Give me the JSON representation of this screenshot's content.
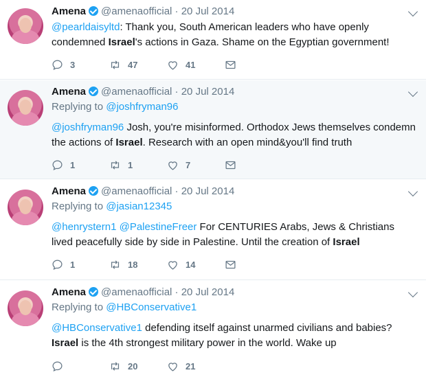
{
  "tweets": [
    {
      "name": "Amena",
      "handle": "@amenaofficial",
      "date": "20 Jul 2014",
      "reply_label": "",
      "reply_to": "",
      "text_parts": [
        "@pearldaisyltd",
        ": Thank you, South American leaders who have openly condemned ",
        "Israel",
        "'s actions in Gaza. Shame on the Egyptian government!"
      ],
      "replies": "3",
      "retweets": "47",
      "likes": "41"
    },
    {
      "name": "Amena",
      "handle": "@amenaofficial",
      "date": "20 Jul 2014",
      "reply_label": "Replying to",
      "reply_to": "@joshfryman96",
      "text_parts": [
        "@joshfryman96",
        " Josh, you're misinformed. Orthodox Jews themselves condemn the actions of ",
        "Israel",
        ". Research with an open mind&you'll find truth"
      ],
      "replies": "1",
      "retweets": "1",
      "likes": "7"
    },
    {
      "name": "Amena",
      "handle": "@amenaofficial",
      "date": "20 Jul 2014",
      "reply_label": "Replying to",
      "reply_to": "@jasian12345",
      "text_parts": [
        "@henrystern1 @PalestineFreer",
        " For CENTURIES Arabs, Jews & Christians lived peacefully side by side in Palestine. Until the creation of ",
        "Israel",
        ""
      ],
      "replies": "1",
      "retweets": "18",
      "likes": "14"
    },
    {
      "name": "Amena",
      "handle": "@amenaofficial",
      "date": "20 Jul 2014",
      "reply_label": "Replying to",
      "reply_to": "@HBConservative1",
      "text_parts": [
        "@HBConservative1",
        " defending itself against unarmed civilians and babies? ",
        "Israel",
        " is the 4th strongest military power in the world. Wake up"
      ],
      "replies": "",
      "retweets": "20",
      "likes": "21"
    }
  ],
  "colors": {
    "link": "#1da1f2",
    "muted": "#657786",
    "highlight_bg": "#f5f8fa"
  }
}
